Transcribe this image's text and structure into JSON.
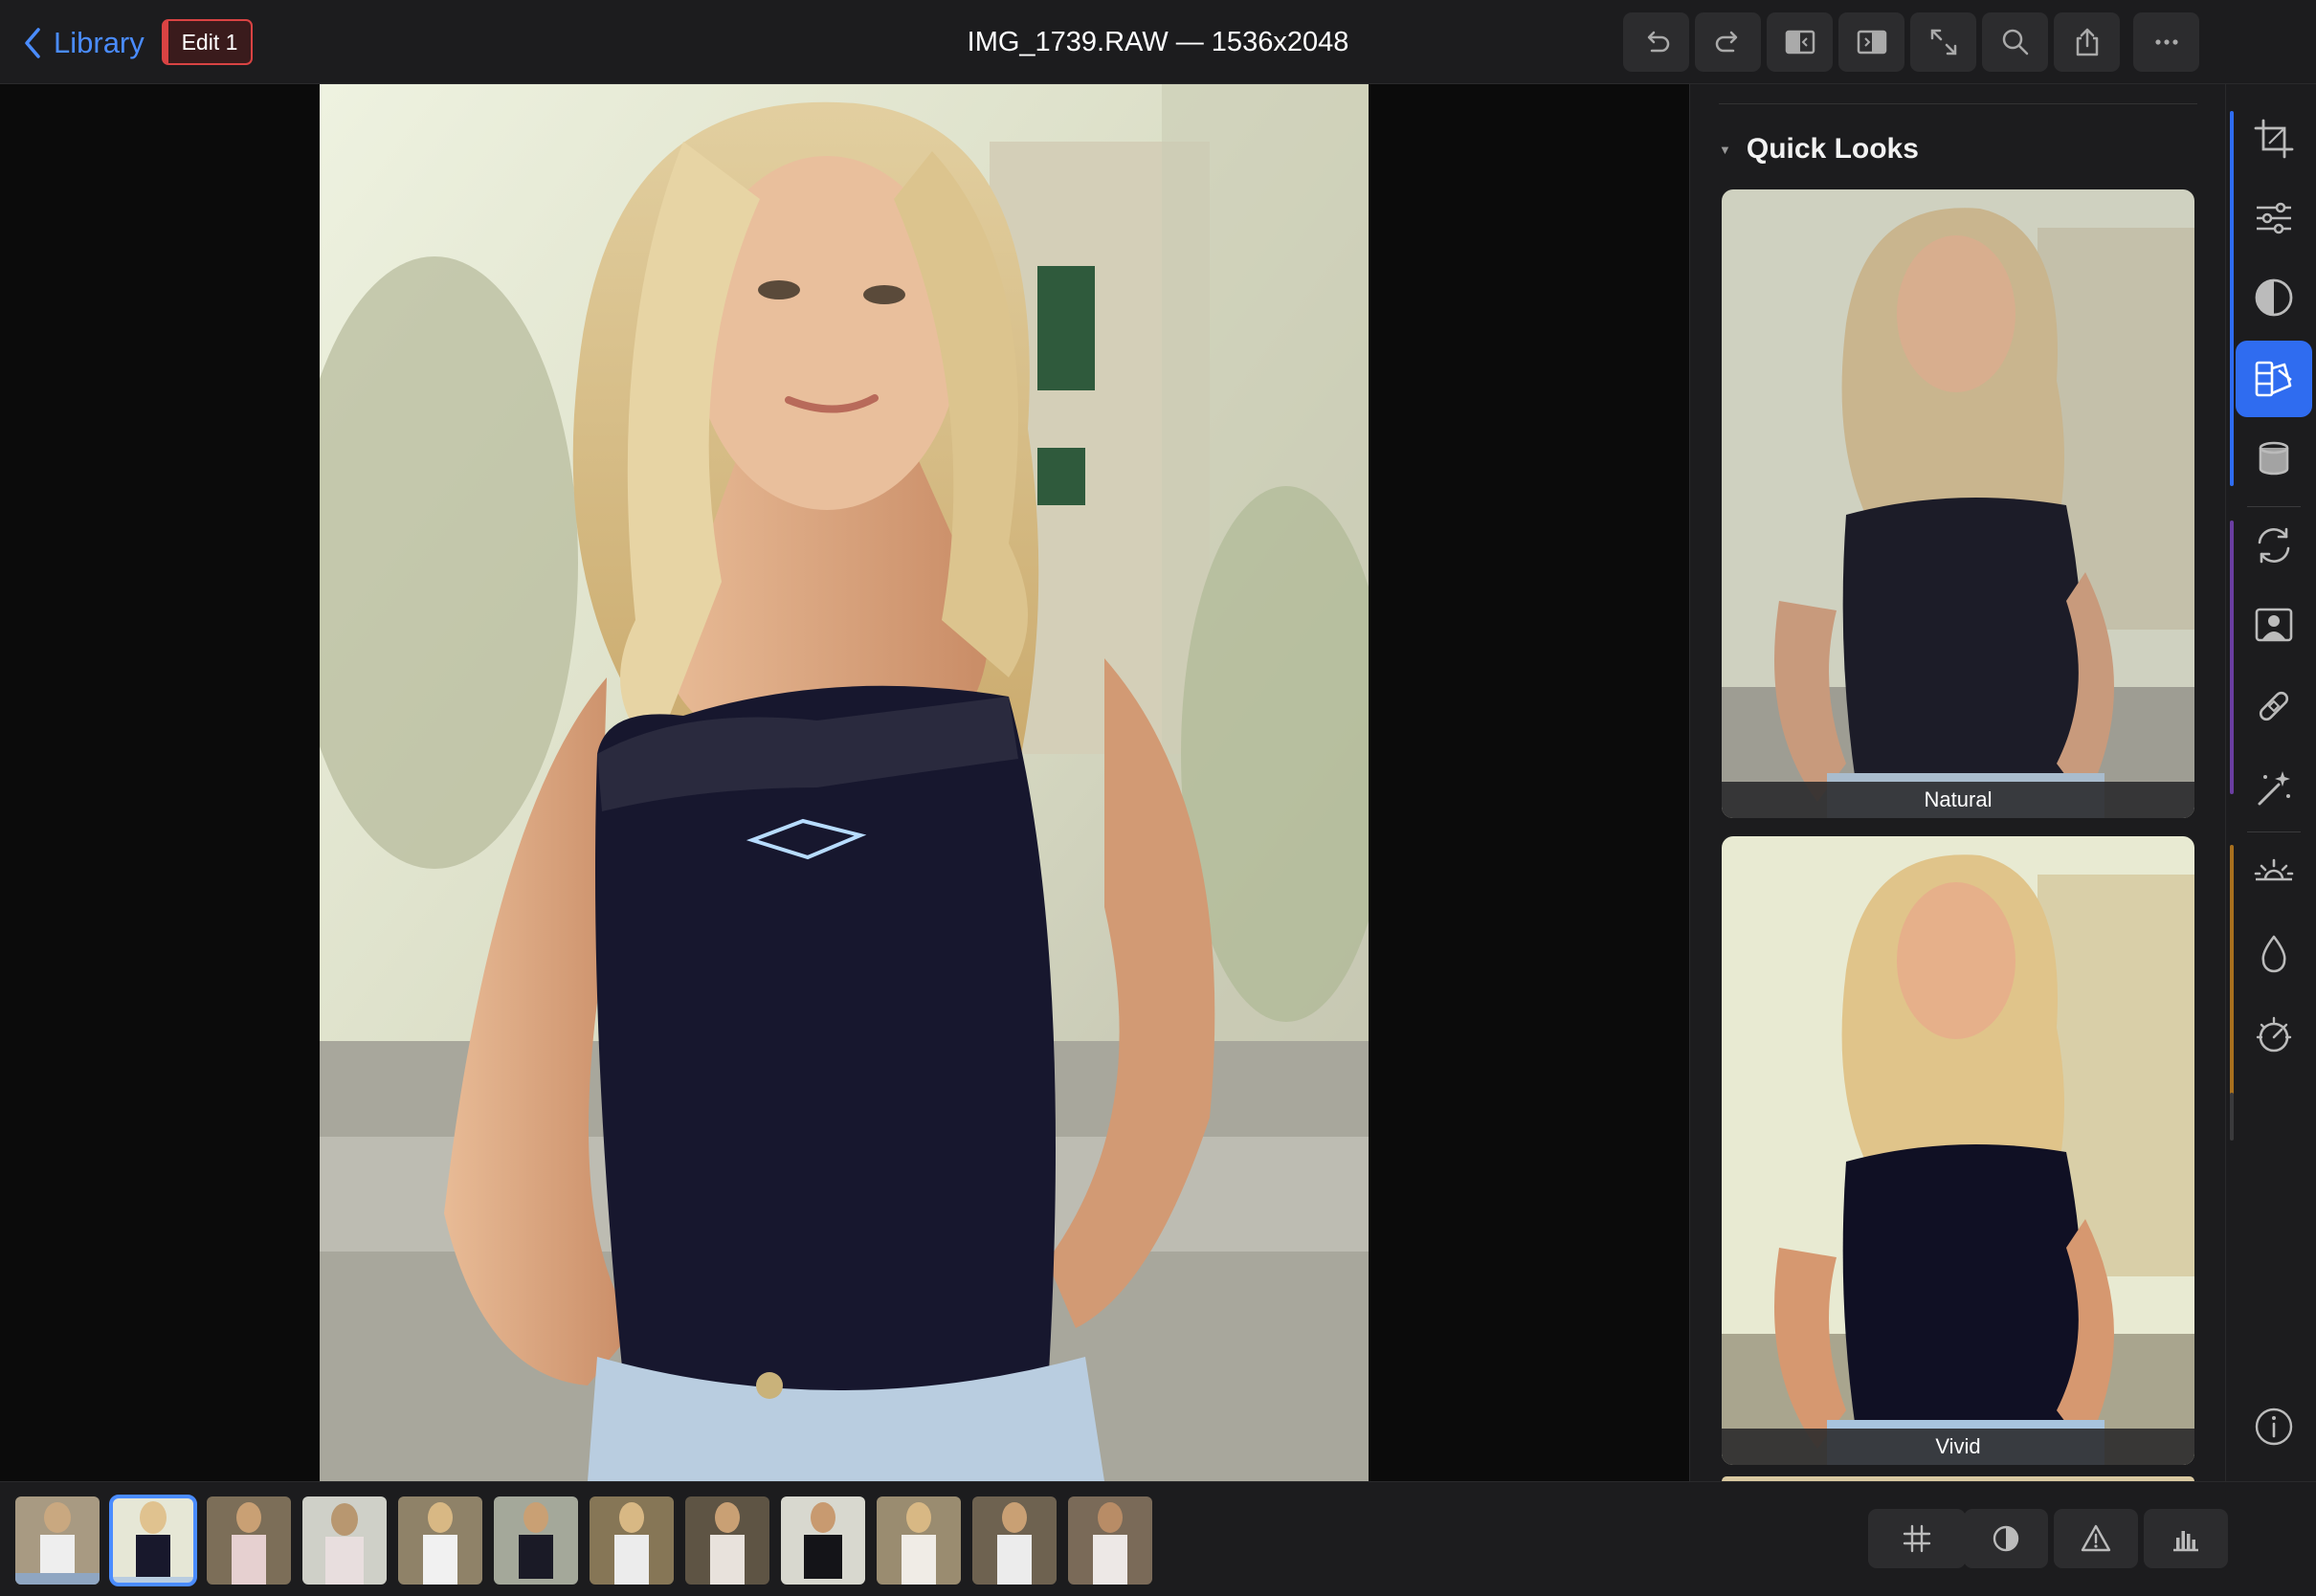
{
  "topbar": {
    "back_label": "Library",
    "edit_badge": "Edit 1",
    "title": "IMG_1739.RAW — 1536x2048",
    "buttons": [
      "undo-icon",
      "redo-icon",
      "compare-before-icon",
      "compare-after-icon",
      "fullscreen-icon",
      "zoom-icon",
      "share-icon",
      "more-icon"
    ]
  },
  "panel": {
    "section_title": "Quick Looks",
    "looks": [
      {
        "label": "Natural"
      },
      {
        "label": "Vivid"
      }
    ]
  },
  "rail": {
    "tools": [
      "crop-icon",
      "adjustments-icon",
      "tone-icon",
      "looks-icon",
      "lut-icon",
      "sync-icon",
      "portrait-icon",
      "heal-icon",
      "magic-wand-icon",
      "exposure-icon",
      "color-drop-icon",
      "gauge-icon",
      "info-icon"
    ],
    "active_tool": "looks-icon",
    "accent_colors": {
      "blue": "#2f6cf0",
      "purple": "#6a3ea1",
      "orange": "#a8701e"
    }
  },
  "filmstrip": {
    "thumbnail_count": 12,
    "selected_index": 1,
    "buttons": [
      "grid-icon",
      "contrast-icon",
      "warning-icon",
      "histogram-icon"
    ]
  },
  "colors": {
    "accent_blue": "#4a8cff",
    "edit_red": "#d94343",
    "panel_bg": "#1c1c1e"
  }
}
